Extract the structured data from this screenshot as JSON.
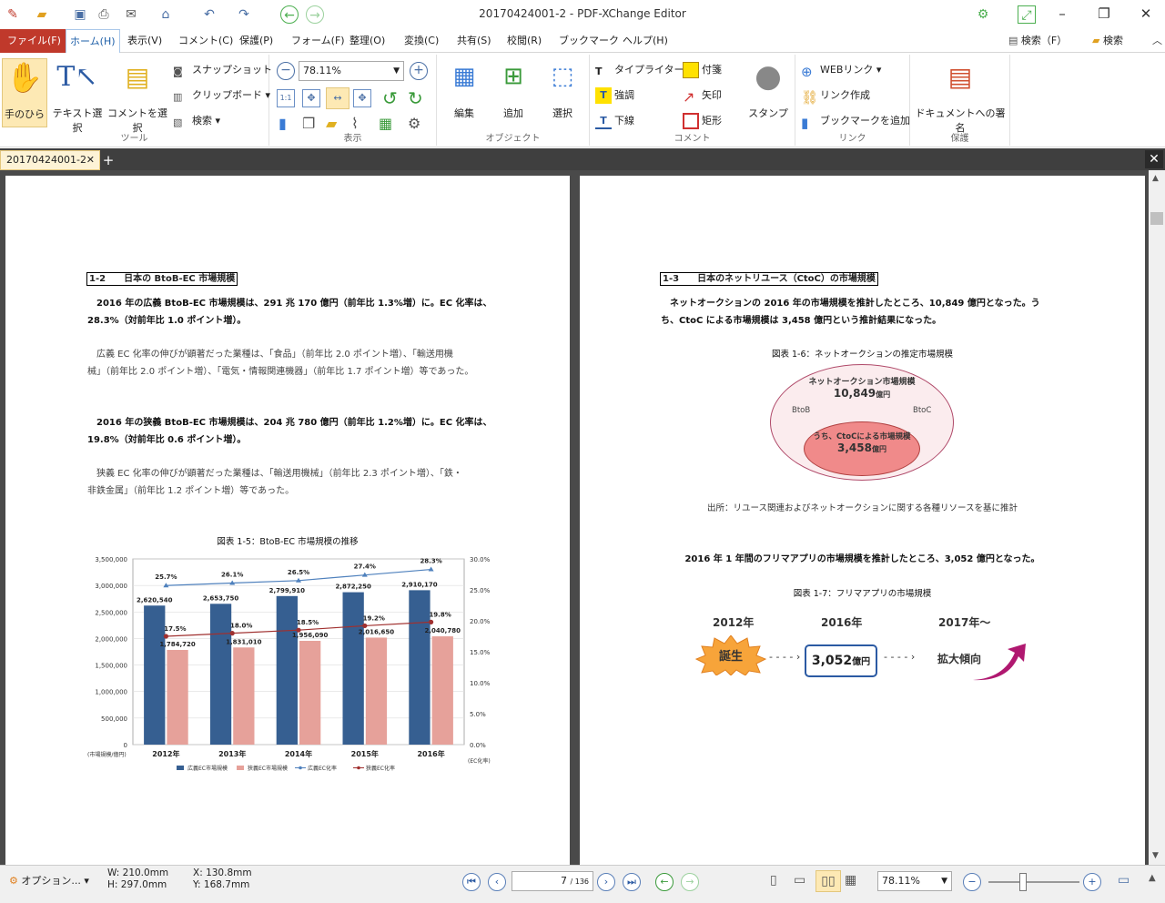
{
  "window": {
    "title": "20170424001-2 - PDF-XChange Editor"
  },
  "menu": {
    "items": [
      "ファイル(F)",
      "ホーム(H)",
      "表示(V)",
      "コメント(C)",
      "保護(P)",
      "フォーム(F)",
      "整理(O)",
      "変換(C)",
      "共有(S)",
      "校閲(R)",
      "ブックマーク",
      "ヘルプ(H)"
    ],
    "search": "検索（F）",
    "search2": "検索"
  },
  "ribbon": {
    "hand": "手のひら",
    "text_select": "テキスト選択",
    "comment_select": "コメントを選択",
    "snapshot": "スナップショット",
    "clipboard": "クリップボード",
    "search": "検索",
    "tools_group": "ツール",
    "zoom": "78.11%",
    "view_group": "表示",
    "edit": "編集",
    "add": "追加",
    "select": "選択",
    "object_group": "オブジェクト",
    "typewriter": "タイプライター",
    "sticky": "付箋",
    "highlight": "強調",
    "arrow": "矢印",
    "underline": "下線",
    "rect": "矩形",
    "stamp": "スタンプ",
    "comment_group": "コメント",
    "weblink": "WEBリンク",
    "create_link": "リンク作成",
    "add_bookmark": "ブックマークを追加",
    "link_group": "リンク",
    "sign": "ドキュメントへの署名",
    "protect_group": "保護"
  },
  "tab": {
    "name": "20170424001-2"
  },
  "left_page": {
    "heading": "1-2　　日本の BtoB-EC 市場規模",
    "p1a": "　2016 年の広義 BtoB-EC 市場規模は、291 兆 170 億円（前年比 1.3%増）に。EC 化率は、",
    "p1b": "28.3%（対前年比 1.0 ポイント増）。",
    "p2a": "　広義 EC 化率の伸びが顕著だった業種は、「食品」（前年比 2.0 ポイント増）、「輸送用機",
    "p2b": "械」（前年比 2.0 ポイント増）、「電気・情報関連機器」（前年比 1.7 ポイント増）等であった。",
    "p3a": "　2016 年の狭義 BtoB-EC 市場規模は、204 兆 780 億円（前年比 1.2%増）に。EC 化率は、",
    "p3b": "19.8%（対前年比 0.6 ポイント増）。",
    "p4a": "　狭義 EC 化率の伸びが顕著だった業種は、「輸送用機械」（前年比 2.3 ポイント増）、「鉄・",
    "p4b": "非鉄金属」（前年比 1.2 ポイント増）等であった。",
    "chart_caption": "図表 1-5：BtoB-EC 市場規模の推移"
  },
  "chart_data": {
    "type": "bar",
    "categories": [
      "2012年",
      "2013年",
      "2014年",
      "2015年",
      "2016年"
    ],
    "series": [
      {
        "name": "広義EC市場規模",
        "values": [
          2620540,
          2653750,
          2799910,
          2872250,
          2910170
        ],
        "color": "#365f91"
      },
      {
        "name": "狭義EC市場規模",
        "values": [
          1784720,
          1831010,
          1956090,
          2016650,
          2040780
        ],
        "color": "#e6a19a"
      },
      {
        "name": "広義EC化率",
        "values": [
          25.7,
          26.1,
          26.5,
          27.4,
          28.3
        ],
        "color": "#4f81bd",
        "axis": "right"
      },
      {
        "name": "狭義EC化率",
        "values": [
          17.5,
          18.0,
          18.5,
          19.2,
          19.8
        ],
        "color": "#a0302f",
        "axis": "right"
      }
    ],
    "value_labels": {
      "bars1": [
        "2,620,540",
        "2,653,750",
        "2,799,910",
        "2,872,250",
        "2,910,170"
      ],
      "bars2": [
        "1,784,720",
        "1,831,010",
        "1,956,090",
        "2,016,650",
        "2,040,780"
      ],
      "rate1": [
        "25.7%",
        "26.1%",
        "26.5%",
        "27.4%",
        "28.3%"
      ],
      "rate2": [
        "17.5%",
        "18.0%",
        "18.5%",
        "19.2%",
        "19.8%"
      ]
    },
    "ylim": [
      0,
      3500000
    ],
    "yticks": [
      "3,500,000",
      "3,000,000",
      "2,500,000",
      "2,000,000",
      "1,500,000",
      "1,000,000",
      "500,000",
      "0"
    ],
    "y2lim": [
      0,
      30
    ],
    "y2ticks": [
      "30.0%",
      "25.0%",
      "20.0%",
      "15.0%",
      "10.0%",
      "5.0%",
      "0.0%"
    ],
    "ylabel": "(市場規模/億円)",
    "y2label": "(EC化率)",
    "legend": "bottom"
  },
  "right_page": {
    "heading": "1-3　　日本のネットリユース（CtoC）の市場規模",
    "p1a": "　ネットオークションの 2016 年の市場規模を推計したところ、10,849 億円となった。う",
    "p1b": "ち、CtoC による市場規模は 3,458 億円という推計結果になった。",
    "fig6_caption": "図表 1-6：ネットオークションの推定市場規模",
    "outer_title": "ネットオークション市場規模",
    "outer_value": "10,849",
    "oku": "億円",
    "btob": "BtoB",
    "btoc": "BtoC",
    "inner_title": "うち、CtoCによる市場規模",
    "inner_value": "3,458",
    "source": "出所：リユース関連およびネットオークションに関する各種リソースを基に推計",
    "p2": "2016 年 1 年間のフリマアプリの市場規模を推計したところ、3,052 億円となった。",
    "fig7_caption": "図表 1-7：フリマアプリの市場規模",
    "y2012": "2012年",
    "y2016": "2016年",
    "y2017": "2017年〜",
    "birth": "誕生",
    "fv": "3,052",
    "expand": "拡大傾向"
  },
  "status": {
    "options": "オプション...",
    "w": "W: 210.0mm",
    "h": "H: 297.0mm",
    "x": "X: 130.8mm",
    "y": "Y: 168.7mm",
    "page": "7",
    "total": "/ 136",
    "zoom": "78.11%"
  }
}
